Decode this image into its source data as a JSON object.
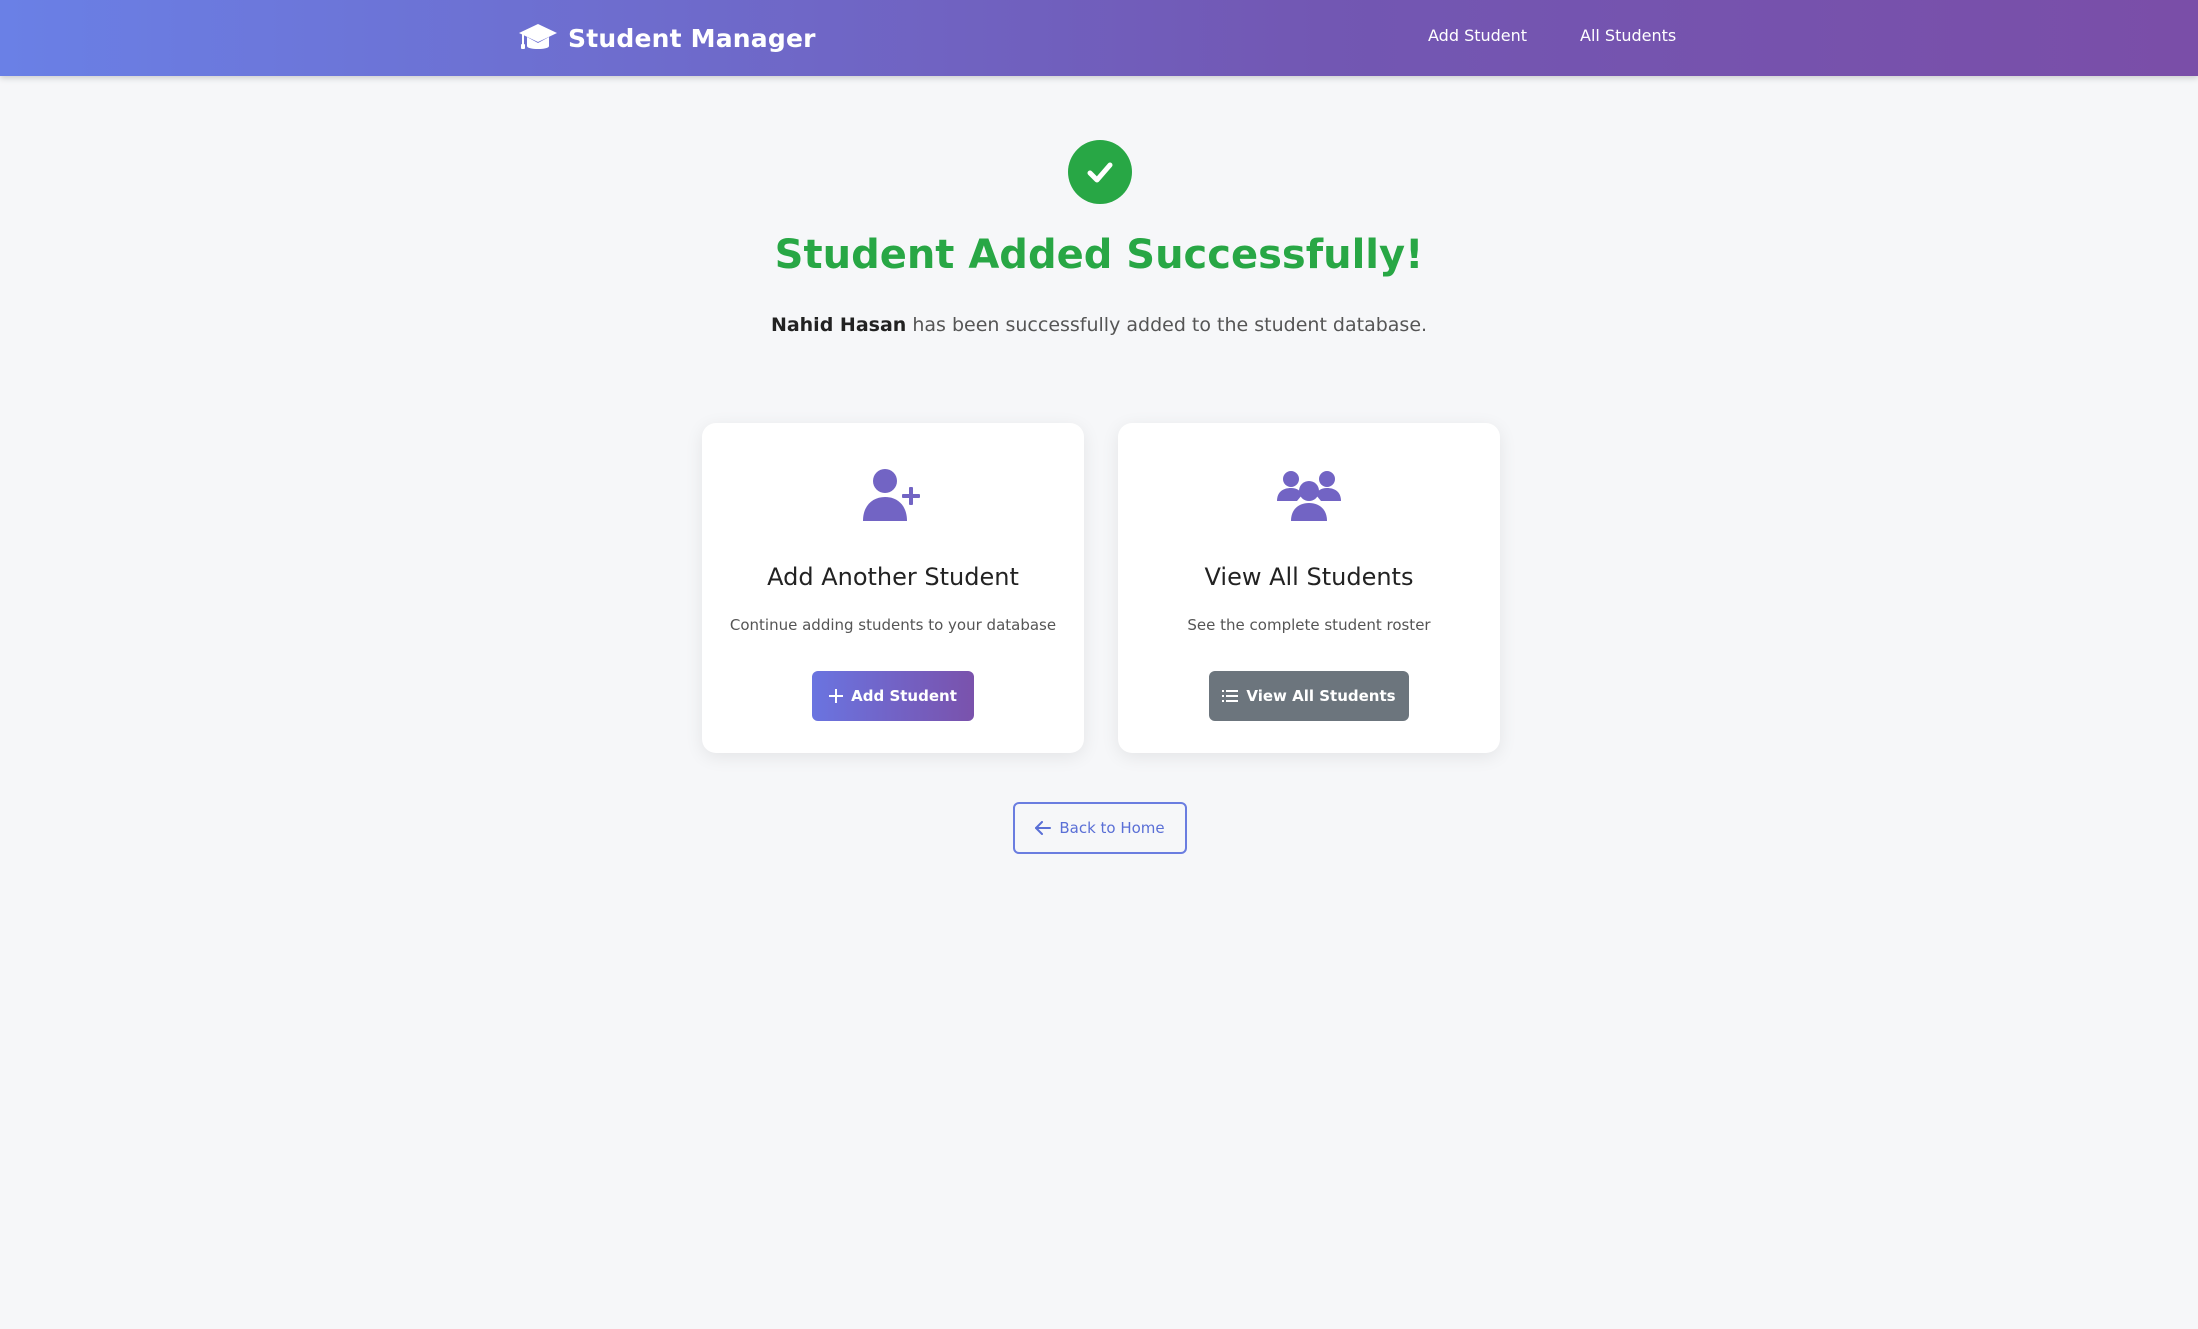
{
  "navbar": {
    "brand": "Student Manager",
    "links": [
      "Add Student",
      "All Students"
    ]
  },
  "success": {
    "title": "Student Added Successfully!",
    "student_name": "Nahid Hasan",
    "message": " has been successfully added to the student database."
  },
  "cards": {
    "add": {
      "title": "Add Another Student",
      "description": "Continue adding students to your database",
      "button": "Add Student"
    },
    "view": {
      "title": "View All Students",
      "description": "See the complete student roster",
      "button": "View All Students"
    }
  },
  "back_button": "Back to Home",
  "colors": {
    "success": "#28a745",
    "accent": "#7257b3",
    "secondary_button": "#6c757d",
    "icon": "#7264c4"
  },
  "icons": {
    "brand": "graduation-cap-icon",
    "success": "check-circle-icon",
    "add_card": "user-plus-icon",
    "view_card": "users-icon",
    "add_button": "plus-icon",
    "view_button": "list-icon",
    "back": "arrow-left-icon"
  }
}
